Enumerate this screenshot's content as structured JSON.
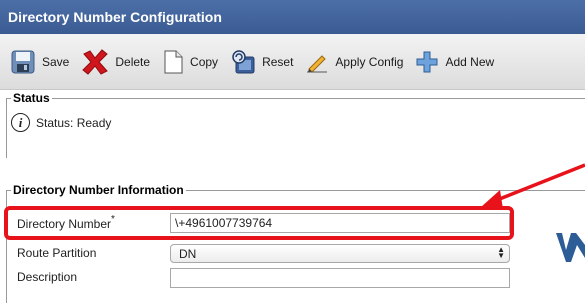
{
  "window": {
    "title": "Directory Number Configuration"
  },
  "toolbar": {
    "save_label": "Save",
    "delete_label": "Delete",
    "copy_label": "Copy",
    "reset_label": "Reset",
    "apply_config_label": "Apply Config",
    "add_new_label": "Add New"
  },
  "status_section": {
    "legend": "Status",
    "status_text": "Status: Ready"
  },
  "directory_section": {
    "legend": "Directory Number Information",
    "directory_number_label": "Directory Number",
    "required_marker": "*",
    "directory_number_value": "\\+4961007739764",
    "route_partition_label": "Route Partition",
    "route_partition_value": "DN",
    "description_label": "Description",
    "description_value": ""
  },
  "annotation": {
    "highlight_color": "#e8121b"
  },
  "colors": {
    "title_bar": "#4d6fa8",
    "accent_red": "#e8121b"
  }
}
